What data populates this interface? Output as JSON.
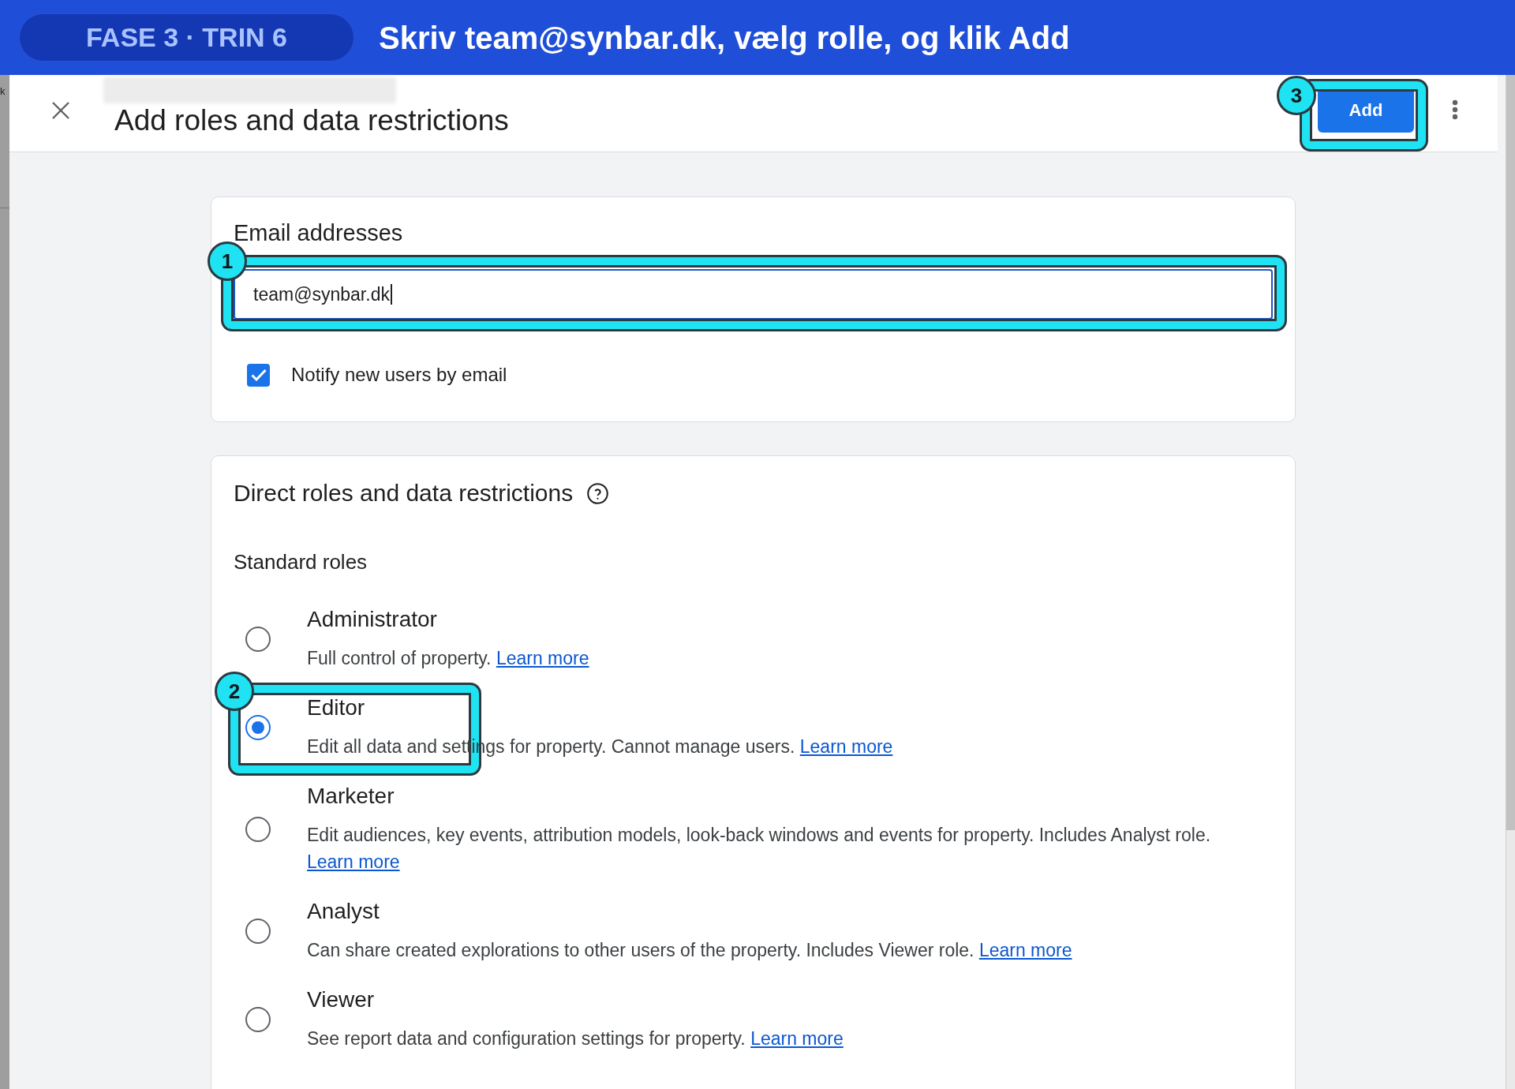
{
  "banner": {
    "step_label": "FASE 3 · TRIN 6",
    "instruction": "Skriv team@synbar.dk, vælg rolle, og klik Add"
  },
  "background_window": {
    "text": "k"
  },
  "dialog": {
    "title": "Add roles and data restrictions",
    "add_button": {
      "label": "Add",
      "step": "3"
    }
  },
  "email_section": {
    "label": "Email addresses",
    "input": {
      "value": "team@synbar.dk",
      "focused": true,
      "step": "1"
    },
    "notify": {
      "label": "Notify new users by email",
      "checked": true
    }
  },
  "roles_section": {
    "title": "Direct roles and data restrictions",
    "subtitle": "Standard roles",
    "roles": [
      {
        "name": "Administrator",
        "description": "Full control of property.",
        "link": "Learn more",
        "selected": false
      },
      {
        "name": "Editor",
        "description": "Edit all data and settings for property. Cannot manage users.",
        "link": "Learn more",
        "selected": true,
        "step": "2"
      },
      {
        "name": "Marketer",
        "description": "Edit audiences, key events, attribution models, look-back windows and events for property. Includes Analyst role.",
        "link": "Learn more",
        "selected": false
      },
      {
        "name": "Analyst",
        "description": "Can share created explorations to other users of the property. Includes Viewer role.",
        "link": "Learn more",
        "selected": false
      },
      {
        "name": "Viewer",
        "description": "See report data and configuration settings for property.",
        "link": "Learn more",
        "selected": false
      }
    ]
  }
}
